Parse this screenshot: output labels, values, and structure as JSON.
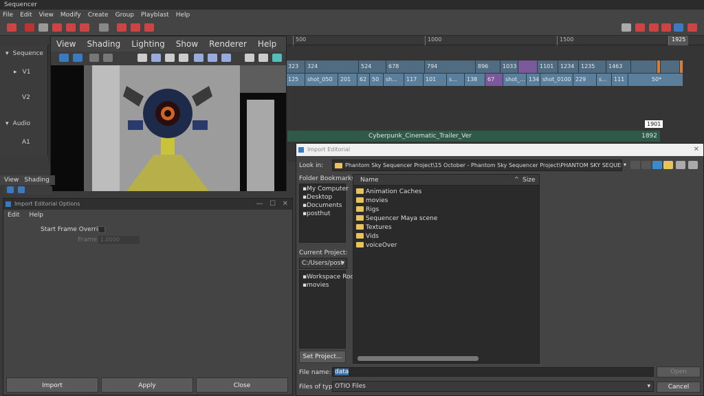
{
  "sequencer": {
    "title": "Sequencer",
    "menu": [
      "File",
      "Edit",
      "View",
      "Modify",
      "Create",
      "Group",
      "Playblast",
      "Help"
    ],
    "ruler": [
      "500",
      "1000",
      "1500",
      "1925"
    ],
    "tracks": {
      "sequence": "Sequence",
      "v1": "V1",
      "v2": "V2",
      "audio": "Audio",
      "a1": "A1"
    },
    "top_row": [
      "323",
      "324",
      "524",
      "678",
      "794",
      "896",
      "1033",
      "1101",
      "1234",
      "1235",
      "1463"
    ],
    "shot_row": [
      "125",
      "shot_050",
      "201",
      "62",
      "50",
      "sh...",
      "117",
      "101",
      "s...",
      "138",
      "67",
      "shot_...",
      "134",
      "shot_0100",
      "229",
      "s...",
      "111",
      "50*"
    ],
    "audio_clip": "Cyberpunk_Cinematic_Trailer_Ver",
    "audio_num_top": "1901",
    "audio_num": "1892"
  },
  "viewport": {
    "menu": [
      "View",
      "Shading",
      "Lighting",
      "Show",
      "Renderer",
      "Help"
    ],
    "menu2": [
      "View",
      "Shading"
    ]
  },
  "options": {
    "title": "Import Editorial Options",
    "menu": [
      "Edit",
      "Help"
    ],
    "start_frame_label": "Start Frame Override",
    "frame_label": "Frame",
    "frame_value": "1.0000",
    "import": "Import",
    "apply": "Apply",
    "close": "Close"
  },
  "dialog": {
    "title": "Import Editorial",
    "look_in": "Look in:",
    "path": "Phantom Sky Sequencer Project\\15 October - Phantom Sky Sequencer Project\\PHANTOM SKY SEQUENCER",
    "bookmarks_label": "Folder Bookmarks:",
    "bookmarks": [
      "My Computer",
      "Desktop",
      "Documents",
      "posthut"
    ],
    "current_project_label": "Current Project:",
    "current_project": "C:/Users/post",
    "project_items": [
      "Workspace Root",
      "movies"
    ],
    "set_project": "Set Project...",
    "col_name": "Name",
    "col_size": "Size",
    "files": [
      "Animation Caches",
      "movies",
      "Rigs",
      "Sequencer Maya scene",
      "Textures",
      "Vids",
      "voiceOver"
    ],
    "file_name_label": "File name:",
    "file_name": "data",
    "files_of_type_label": "Files of type:",
    "files_of_type": "OTIO Files",
    "open": "Open",
    "cancel": "Cancel"
  },
  "colors": {
    "shot": "#5b7f9a",
    "accent": "#e07b2f",
    "highlight": "#7a5a9a"
  }
}
